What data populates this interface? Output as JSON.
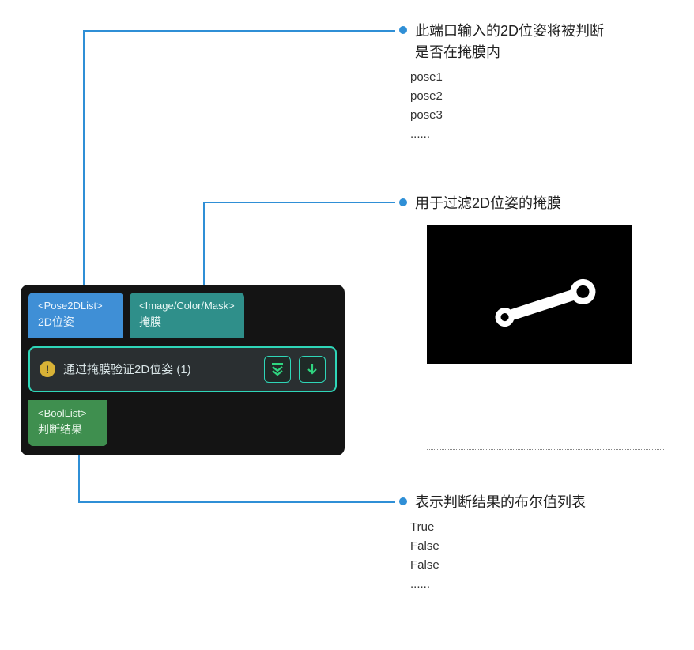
{
  "node": {
    "input_ports": [
      {
        "type": "<Pose2DList>",
        "label": "2D位姿"
      },
      {
        "type": "<Image/Color/Mask>",
        "label": "掩膜"
      }
    ],
    "title": "通过掩膜验证2D位姿 (1)",
    "output_port": {
      "type": "<BoolList>",
      "label": "判断结果"
    }
  },
  "callouts": {
    "pose_input": {
      "title_line1": "此端口输入的2D位姿将被判断",
      "title_line2": "是否在掩膜内",
      "examples": [
        "pose1",
        "pose2",
        "pose3",
        "......"
      ]
    },
    "mask_input": {
      "title": "用于过滤2D位姿的掩膜"
    },
    "result_output": {
      "title": "表示判断结果的布尔值列表",
      "examples": [
        "True",
        "False",
        "False",
        "......"
      ]
    }
  }
}
